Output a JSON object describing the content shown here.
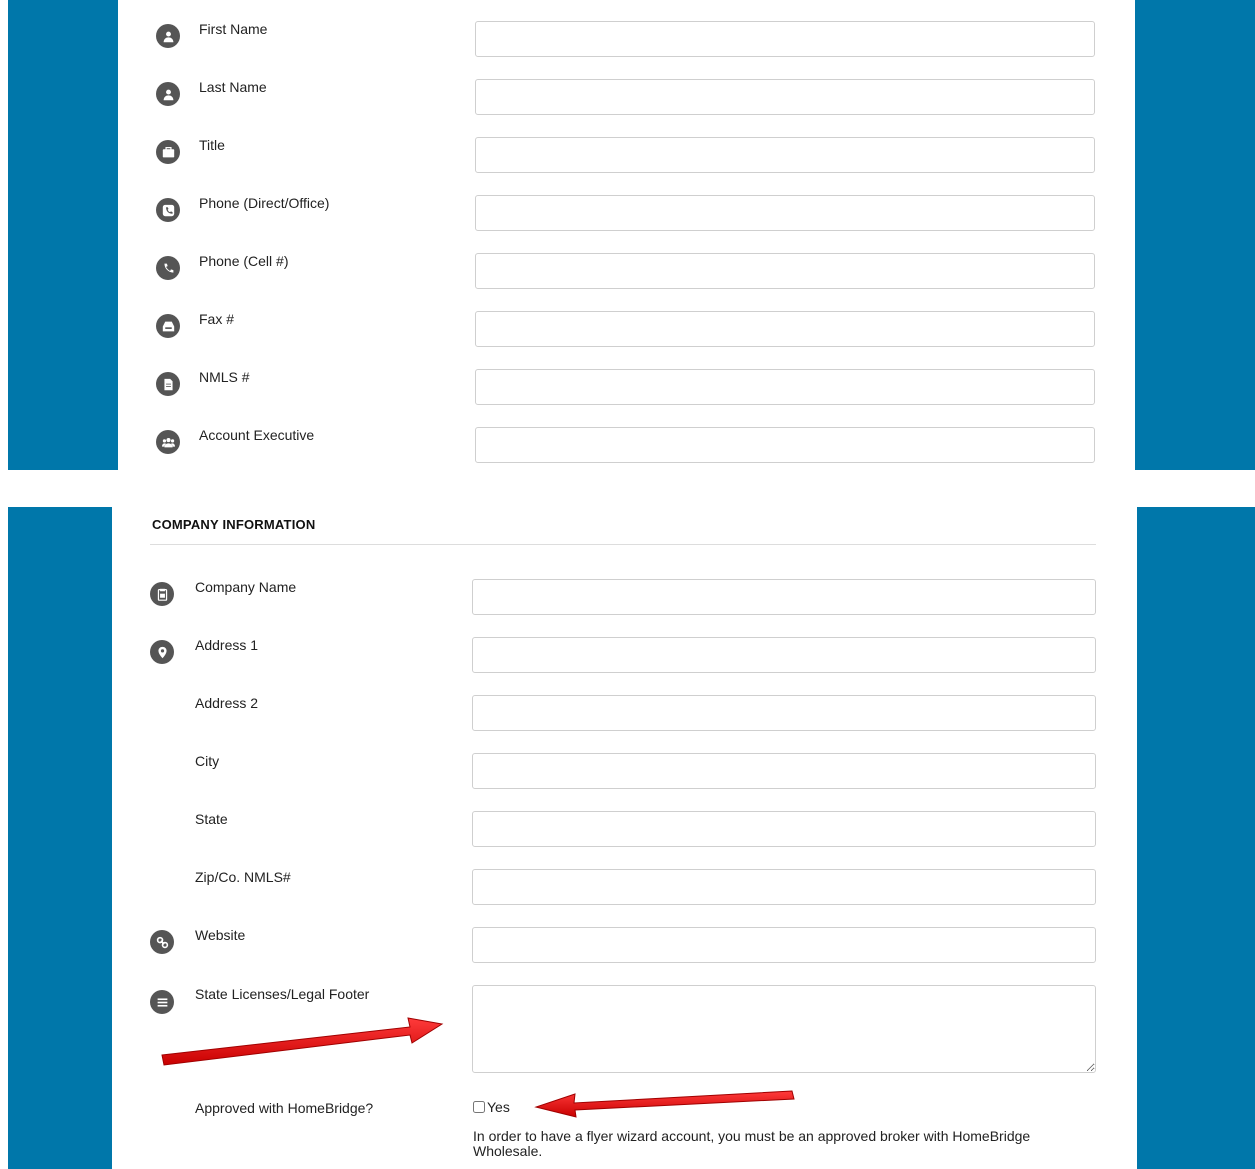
{
  "personal_fields": [
    {
      "label": "First Name",
      "icon": "user-icon",
      "value": ""
    },
    {
      "label": "Last Name",
      "icon": "user-icon",
      "value": ""
    },
    {
      "label": "Title",
      "icon": "briefcase-icon",
      "value": ""
    },
    {
      "label": "Phone (Direct/Office)",
      "icon": "phone-square-icon",
      "value": ""
    },
    {
      "label": "Phone (Cell #)",
      "icon": "phone-icon",
      "value": ""
    },
    {
      "label": "Fax #",
      "icon": "fax-icon",
      "value": ""
    },
    {
      "label": "NMLS #",
      "icon": "document-icon",
      "value": ""
    },
    {
      "label": "Account Executive",
      "icon": "group-icon",
      "value": ""
    }
  ],
  "company": {
    "section_title": "COMPANY INFORMATION",
    "fields": [
      {
        "label": "Company Name",
        "icon": "clipboard-icon",
        "value": ""
      },
      {
        "label": "Address 1",
        "icon": "map-marker-icon",
        "value": ""
      },
      {
        "label": "Address 2",
        "icon": "",
        "value": ""
      },
      {
        "label": "City",
        "icon": "",
        "value": ""
      },
      {
        "label": "State",
        "icon": "",
        "value": ""
      },
      {
        "label": "Zip/Co. NMLS#",
        "icon": "",
        "value": ""
      },
      {
        "label": "Website",
        "icon": "link-icon",
        "value": ""
      }
    ],
    "footer_label": "State Licenses/Legal Footer",
    "footer_icon": "list-icon",
    "footer_value": "",
    "approved_label": "Approved with HomeBridge?",
    "approved_option": "Yes",
    "approved_checked": false,
    "approved_note": "In order to have a flyer wizard account, you must be an approved broker with HomeBridge Wholesale."
  },
  "colors": {
    "side_blue": "#0077aa",
    "icon_bg": "#555555",
    "annotation_arrow": "#e01010"
  }
}
